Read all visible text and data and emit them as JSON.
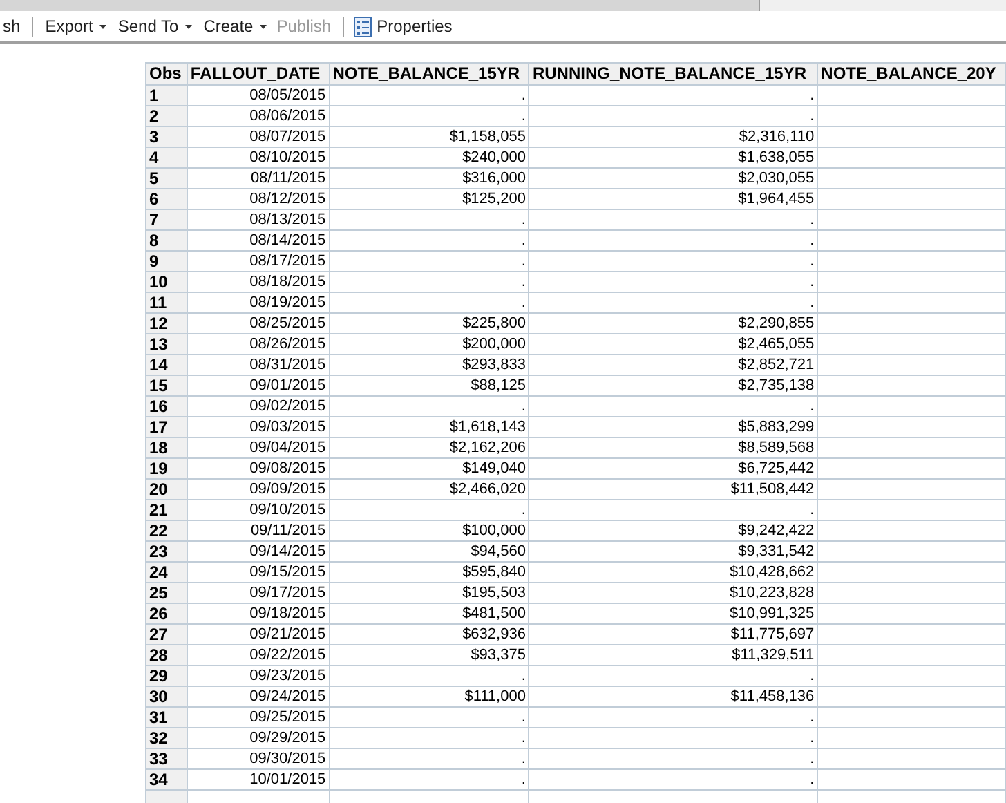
{
  "toolbar": [
    {
      "kind": "text",
      "label": "sh",
      "disabled": false
    },
    {
      "kind": "separator"
    },
    {
      "kind": "menu",
      "label": "Export",
      "disabled": false
    },
    {
      "kind": "menu",
      "label": "Send To",
      "disabled": false
    },
    {
      "kind": "menu",
      "label": "Create",
      "disabled": false
    },
    {
      "kind": "text",
      "label": "Publish",
      "disabled": true
    },
    {
      "kind": "separator"
    },
    {
      "kind": "icon",
      "label": "Properties",
      "disabled": false
    }
  ],
  "table": {
    "columns": [
      "Obs",
      "FALLOUT_DATE",
      "NOTE_BALANCE_15YR",
      "RUNNING_NOTE_BALANCE_15YR",
      "NOTE_BALANCE_20Y"
    ],
    "rows": [
      [
        "1",
        "08/05/2015",
        ".",
        "."
      ],
      [
        "2",
        "08/06/2015",
        ".",
        "."
      ],
      [
        "3",
        "08/07/2015",
        "$1,158,055",
        "$2,316,110"
      ],
      [
        "4",
        "08/10/2015",
        "$240,000",
        "$1,638,055"
      ],
      [
        "5",
        "08/11/2015",
        "$316,000",
        "$2,030,055"
      ],
      [
        "6",
        "08/12/2015",
        "$125,200",
        "$1,964,455"
      ],
      [
        "7",
        "08/13/2015",
        ".",
        "."
      ],
      [
        "8",
        "08/14/2015",
        ".",
        "."
      ],
      [
        "9",
        "08/17/2015",
        ".",
        "."
      ],
      [
        "10",
        "08/18/2015",
        ".",
        "."
      ],
      [
        "11",
        "08/19/2015",
        ".",
        "."
      ],
      [
        "12",
        "08/25/2015",
        "$225,800",
        "$2,290,855"
      ],
      [
        "13",
        "08/26/2015",
        "$200,000",
        "$2,465,055"
      ],
      [
        "14",
        "08/31/2015",
        "$293,833",
        "$2,852,721"
      ],
      [
        "15",
        "09/01/2015",
        "$88,125",
        "$2,735,138"
      ],
      [
        "16",
        "09/02/2015",
        ".",
        "."
      ],
      [
        "17",
        "09/03/2015",
        "$1,618,143",
        "$5,883,299"
      ],
      [
        "18",
        "09/04/2015",
        "$2,162,206",
        "$8,589,568"
      ],
      [
        "19",
        "09/08/2015",
        "$149,040",
        "$6,725,442"
      ],
      [
        "20",
        "09/09/2015",
        "$2,466,020",
        "$11,508,442"
      ],
      [
        "21",
        "09/10/2015",
        ".",
        "."
      ],
      [
        "22",
        "09/11/2015",
        "$100,000",
        "$9,242,422"
      ],
      [
        "23",
        "09/14/2015",
        "$94,560",
        "$9,331,542"
      ],
      [
        "24",
        "09/15/2015",
        "$595,840",
        "$10,428,662"
      ],
      [
        "25",
        "09/17/2015",
        "$195,503",
        "$10,223,828"
      ],
      [
        "26",
        "09/18/2015",
        "$481,500",
        "$10,991,325"
      ],
      [
        "27",
        "09/21/2015",
        "$632,936",
        "$11,775,697"
      ],
      [
        "28",
        "09/22/2015",
        "$93,375",
        "$11,329,511"
      ],
      [
        "29",
        "09/23/2015",
        ".",
        "."
      ],
      [
        "30",
        "09/24/2015",
        "$111,000",
        "$11,458,136"
      ],
      [
        "31",
        "09/25/2015",
        ".",
        "."
      ],
      [
        "32",
        "09/29/2015",
        ".",
        "."
      ],
      [
        "33",
        "09/30/2015",
        ".",
        "."
      ],
      [
        "34",
        "10/01/2015",
        ".",
        "."
      ]
    ]
  }
}
